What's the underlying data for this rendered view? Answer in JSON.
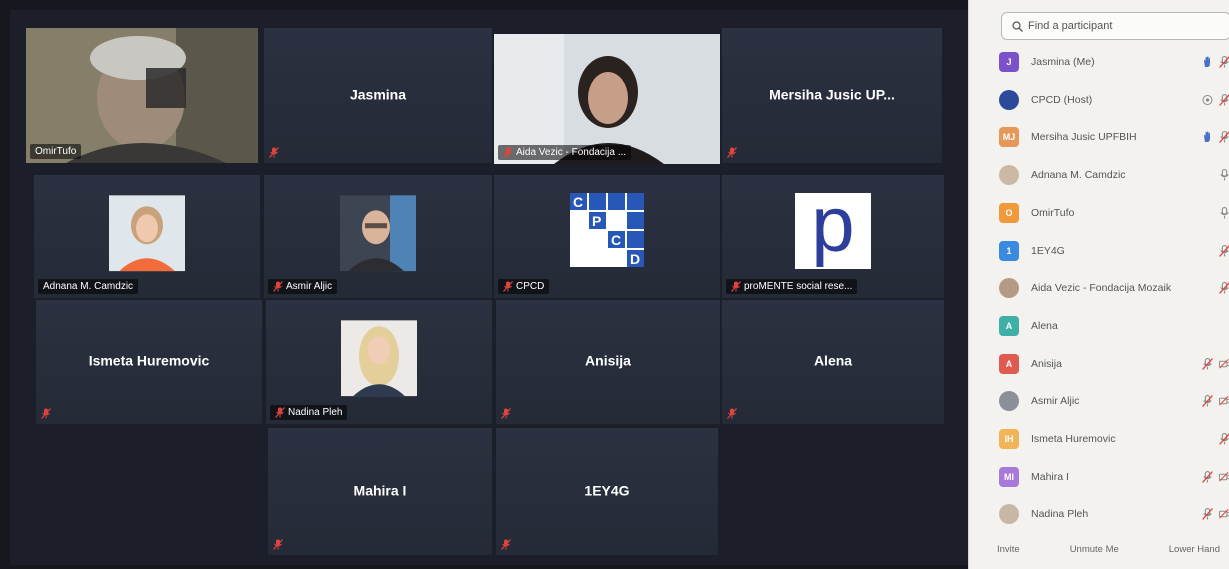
{
  "colors": {
    "active_speaker": "#cfe36a",
    "mute_red": "#e0443e",
    "tile_bg": "#2b3140",
    "panel_bg": "#f3f2ee"
  },
  "grid": {
    "tiles": [
      {
        "id": "omir",
        "name": "",
        "label": "OmirTufo",
        "muted": false,
        "type": "camera"
      },
      {
        "id": "jasmina",
        "name": "Jasmina",
        "label": "",
        "muted": true,
        "type": "name"
      },
      {
        "id": "aida",
        "name": "",
        "label": "Aida Vezic - Fondacija ...",
        "muted": true,
        "type": "camera"
      },
      {
        "id": "mersiha",
        "name": "Mersiha Jusic UP...",
        "label": "",
        "muted": true,
        "type": "name"
      },
      {
        "id": "adnana",
        "name": "",
        "label": "Adnana M. Camdzic",
        "muted": false,
        "type": "photo"
      },
      {
        "id": "asmir",
        "name": "",
        "label": "Asmir Aljic",
        "muted": true,
        "type": "photo"
      },
      {
        "id": "cpcd",
        "name": "",
        "label": "CPCD",
        "muted": true,
        "type": "logo"
      },
      {
        "id": "promente",
        "name": "",
        "label": "proMENTE social rese...",
        "muted": true,
        "type": "logo"
      },
      {
        "id": "ismeta",
        "name": "Ismeta Huremovic",
        "label": "",
        "muted": true,
        "type": "name"
      },
      {
        "id": "nadina",
        "name": "",
        "label": "Nadina Pleh",
        "muted": true,
        "type": "photo"
      },
      {
        "id": "anisija",
        "name": "Anisija",
        "label": "",
        "muted": true,
        "type": "name"
      },
      {
        "id": "alena",
        "name": "Alena",
        "label": "",
        "muted": true,
        "type": "name"
      },
      {
        "id": "mahira",
        "name": "Mahira I",
        "label": "",
        "muted": true,
        "type": "name"
      },
      {
        "id": "ey4g",
        "name": "1EY4G",
        "label": "",
        "muted": true,
        "type": "name"
      }
    ],
    "cpcd_logo": {
      "letters": [
        "C",
        "P",
        "C",
        "D"
      ]
    },
    "promente_logo": {
      "letter": "p"
    }
  },
  "panel": {
    "search_placeholder": "Find a participant",
    "participants": [
      {
        "initials": "J",
        "name": "Jasmina (Me)",
        "avatar_color": "#7b52c9",
        "icons": [
          "hand-icon",
          "mic-muted-icon"
        ]
      },
      {
        "initials": "",
        "name": "CPCD (Host)",
        "avatar_color": "#2c4a9a",
        "icons": [
          "target-icon",
          "mic-muted-icon"
        ]
      },
      {
        "initials": "MJ",
        "name": "Mersiha Jusic UPFBIH",
        "avatar_color": "#e6985a",
        "icons": [
          "hand-icon",
          "mic-muted-icon"
        ]
      },
      {
        "initials": "",
        "name": "Adnana M. Camdzic",
        "avatar_color": "#cbb9a6",
        "icons": [
          "mic-icon"
        ]
      },
      {
        "initials": "O",
        "name": "OmirTufo",
        "avatar_color": "#f09a3c",
        "icons": [
          "mic-icon"
        ]
      },
      {
        "initials": "1",
        "name": "1EY4G",
        "avatar_color": "#3a8be0",
        "icons": [
          "mic-muted-icon"
        ]
      },
      {
        "initials": "",
        "name": "Aida Vezic - Fondacija Mozaik",
        "avatar_color": "#b59a86",
        "icons": [
          "mic-muted-icon"
        ]
      },
      {
        "initials": "A",
        "name": "Alena",
        "avatar_color": "#3fb0a6",
        "icons": []
      },
      {
        "initials": "A",
        "name": "Anisija",
        "avatar_color": "#e05b4f",
        "icons": [
          "mic-muted-icon",
          "cam-off-icon"
        ]
      },
      {
        "initials": "",
        "name": "Asmir Aljic",
        "avatar_color": "#8a8f99",
        "icons": [
          "mic-muted-icon",
          "cam-off-icon"
        ]
      },
      {
        "initials": "IH",
        "name": "Ismeta Huremovic",
        "avatar_color": "#f2b459",
        "icons": [
          "mic-muted-icon"
        ]
      },
      {
        "initials": "MI",
        "name": "Mahira I",
        "avatar_color": "#a77ad9",
        "icons": [
          "mic-muted-icon",
          "cam-off-icon"
        ]
      },
      {
        "initials": "",
        "name": "Nadina Pleh",
        "avatar_color": "#c9b7a5",
        "icons": [
          "mic-muted-icon",
          "cam-off-icon"
        ]
      }
    ],
    "footer": {
      "invite": "Invite",
      "unmute_me": "Unmute Me",
      "lower_hand": "Lower Hand"
    }
  }
}
